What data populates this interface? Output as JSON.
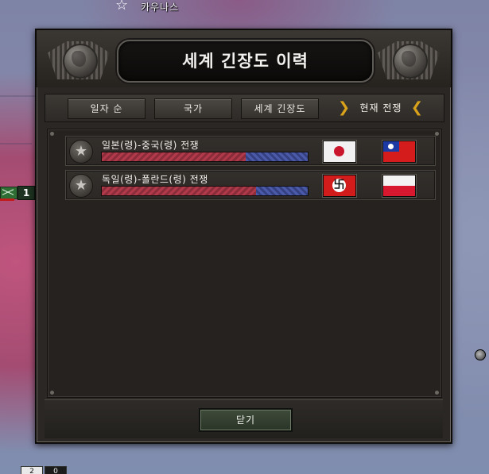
{
  "map": {
    "city_label": "카우나스",
    "unit_count": "1",
    "bottom_boxes": [
      "2",
      "0"
    ]
  },
  "window": {
    "title": "세계 긴장도 이력",
    "tabs": [
      {
        "label": "일자 순",
        "active": false
      },
      {
        "label": "국가",
        "active": false
      },
      {
        "label": "세계 긴장도",
        "active": false
      },
      {
        "label": "현재 전쟁",
        "active": true
      }
    ],
    "wars": [
      {
        "name": "일본(령)-중국(령) 전쟁",
        "attacker_flag": "japan-flag",
        "defender_flag": "china-flag",
        "attacker_share": 0.7
      },
      {
        "name": "독일(령)-폴란드(령) 전쟁",
        "attacker_flag": "germany-flag",
        "defender_flag": "poland-flag",
        "attacker_share": 0.75
      }
    ],
    "close_label": "닫기"
  },
  "colors": {
    "accent_chevron": "#d9a21b",
    "attacker_bar": "#b03a4a",
    "defender_bar": "#4b5aa8",
    "window_bg": "#2a2724"
  }
}
